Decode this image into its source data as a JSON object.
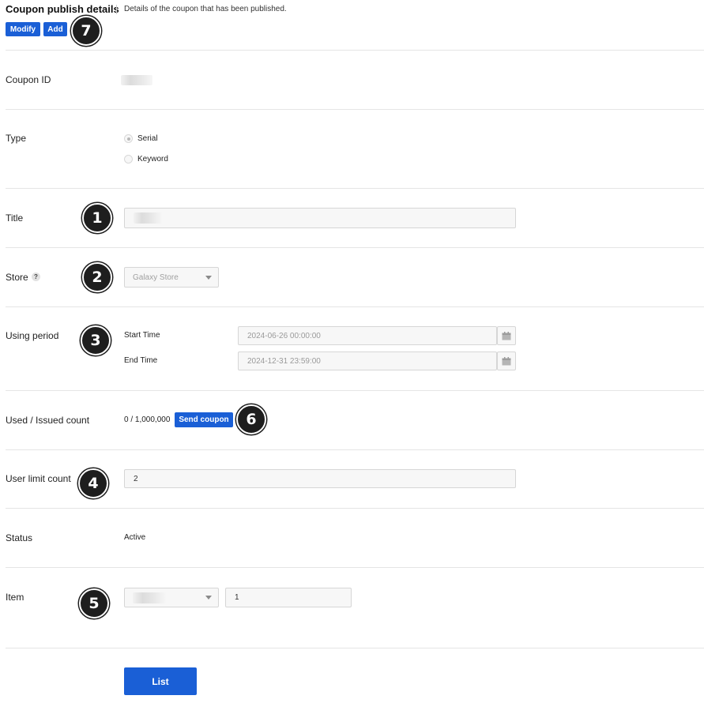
{
  "header": {
    "title": "Coupon publish details",
    "description": "Details of the coupon that has been published.",
    "modify_label": "Modify",
    "add_label": "Add"
  },
  "fields": {
    "coupon_id": {
      "label": "Coupon ID"
    },
    "type": {
      "label": "Type",
      "options": [
        "Serial",
        "Keyword"
      ],
      "selected": "Serial"
    },
    "title": {
      "label": "Title"
    },
    "store": {
      "label": "Store",
      "help": "?",
      "value": "Galaxy Store"
    },
    "using_period": {
      "label": "Using period",
      "start_label": "Start Time",
      "start_value": "2024-06-26 00:00:00",
      "end_label": "End Time",
      "end_value": "2024-12-31 23:59:00"
    },
    "count": {
      "label": "Used / Issued count",
      "value": "0 / 1,000,000",
      "send_label": "Send coupon"
    },
    "user_limit": {
      "label": "User limit count",
      "value": "2"
    },
    "status": {
      "label": "Status",
      "value": "Active"
    },
    "item": {
      "label": "Item",
      "quantity": "1"
    }
  },
  "markers": [
    "1",
    "2",
    "3",
    "4",
    "5",
    "6",
    "7"
  ],
  "footer": {
    "list_label": "List"
  },
  "icons": {
    "calendar": "calendar-icon",
    "caret": "chevron-down-icon",
    "help": "help-icon"
  },
  "colors": {
    "primary": "#1a5fd6",
    "marker": "#1e1e1e"
  }
}
